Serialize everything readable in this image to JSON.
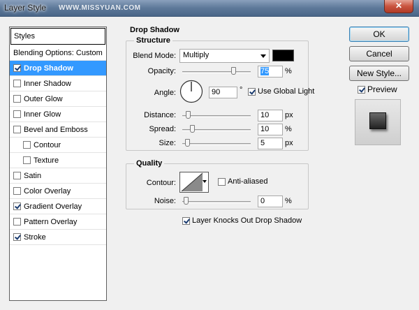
{
  "window": {
    "title": "Layer Style",
    "watermark": "WWW.MISSYUAN.COM",
    "close_glyph": "✕"
  },
  "styles_panel": {
    "header": "Styles",
    "items": [
      {
        "label": "Blending Options: Custom",
        "checkbox": false,
        "checked": false,
        "active": false,
        "sub": false
      },
      {
        "label": "Drop Shadow",
        "checkbox": true,
        "checked": true,
        "active": true,
        "sub": false
      },
      {
        "label": "Inner Shadow",
        "checkbox": true,
        "checked": false,
        "active": false,
        "sub": false
      },
      {
        "label": "Outer Glow",
        "checkbox": true,
        "checked": false,
        "active": false,
        "sub": false
      },
      {
        "label": "Inner Glow",
        "checkbox": true,
        "checked": false,
        "active": false,
        "sub": false
      },
      {
        "label": "Bevel and Emboss",
        "checkbox": true,
        "checked": false,
        "active": false,
        "sub": false
      },
      {
        "label": "Contour",
        "checkbox": true,
        "checked": false,
        "active": false,
        "sub": true
      },
      {
        "label": "Texture",
        "checkbox": true,
        "checked": false,
        "active": false,
        "sub": true
      },
      {
        "label": "Satin",
        "checkbox": true,
        "checked": false,
        "active": false,
        "sub": false
      },
      {
        "label": "Color Overlay",
        "checkbox": true,
        "checked": false,
        "active": false,
        "sub": false
      },
      {
        "label": "Gradient Overlay",
        "checkbox": true,
        "checked": true,
        "active": false,
        "sub": false
      },
      {
        "label": "Pattern Overlay",
        "checkbox": true,
        "checked": false,
        "active": false,
        "sub": false
      },
      {
        "label": "Stroke",
        "checkbox": true,
        "checked": true,
        "active": false,
        "sub": false
      }
    ]
  },
  "drop_shadow": {
    "section_title": "Drop Shadow",
    "structure": {
      "title": "Structure",
      "blend_mode_label": "Blend Mode:",
      "blend_mode_value": "Multiply",
      "shadow_color": "#000000",
      "opacity_label": "Opacity:",
      "opacity_value": "75",
      "opacity_unit": "%",
      "opacity_level": 0.75,
      "angle_label": "Angle:",
      "angle_value": "90",
      "angle_unit": "°",
      "use_global_light_label": "Use Global Light",
      "use_global_light_checked": true,
      "distance_label": "Distance:",
      "distance_value": "10",
      "distance_unit": "px",
      "distance_level": 0.03,
      "spread_label": "Spread:",
      "spread_value": "10",
      "spread_unit": "%",
      "spread_level": 0.1,
      "size_label": "Size:",
      "size_value": "5",
      "size_unit": "px",
      "size_level": 0.02
    },
    "quality": {
      "title": "Quality",
      "contour_label": "Contour:",
      "anti_aliased_label": "Anti-aliased",
      "anti_aliased_checked": false,
      "noise_label": "Noise:",
      "noise_value": "0",
      "noise_unit": "%",
      "noise_level": 0
    },
    "knockout_label": "Layer Knocks Out Drop Shadow",
    "knockout_checked": true
  },
  "buttons": {
    "ok": "OK",
    "cancel": "Cancel",
    "new_style": "New Style...",
    "preview_label": "Preview",
    "preview_checked": true
  }
}
